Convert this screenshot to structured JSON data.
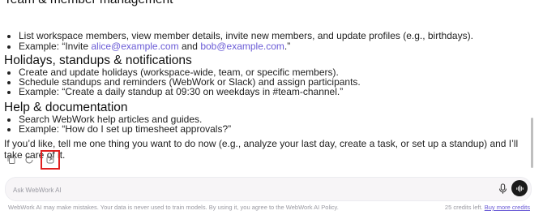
{
  "section_team": {
    "heading": "Team & member management",
    "items": [
      "List workspace members, view member details, invite new members, and update profiles (e.g., birthdays).",
      "Example: “Invite "
    ],
    "example_email1": "alice@example.com",
    "example_and": " and ",
    "example_email2": "bob@example.com",
    "example_end": ".”"
  },
  "section_holidays": {
    "heading": "Holidays, standups & notifications",
    "items": [
      "Create and update holidays (workspace-wide, team, or specific members).",
      "Schedule standups and reminders (WebWork or Slack) and assign participants.",
      "Example: “Create a daily standup at 09:30 on weekdays in #team-channel.”"
    ]
  },
  "section_help": {
    "heading": "Help & documentation",
    "items": [
      "Search WebWork help articles and guides.",
      "Example: “How do I set up timesheet approvals?”"
    ]
  },
  "closing": "If you’d like, tell me one thing you want to do now (e.g., analyze your last day, create a task, or set up a standup) and I’ll take care of it.",
  "actions": {
    "icons": [
      "copy-icon",
      "regenerate-icon",
      "share-icon"
    ]
  },
  "input": {
    "placeholder": "Ask WebWork AI"
  },
  "footer": {
    "disclaimer": "WebWork AI may make mistakes. Your data is never used to train models. By using it, you agree to the WebWork AI Policy.",
    "credits": "25 credits left.",
    "buy_more": "Buy more credits"
  },
  "colors": {
    "link": "#6a5bd6",
    "highlight_border": "#e02020",
    "send_button": "#1a1a1a"
  }
}
